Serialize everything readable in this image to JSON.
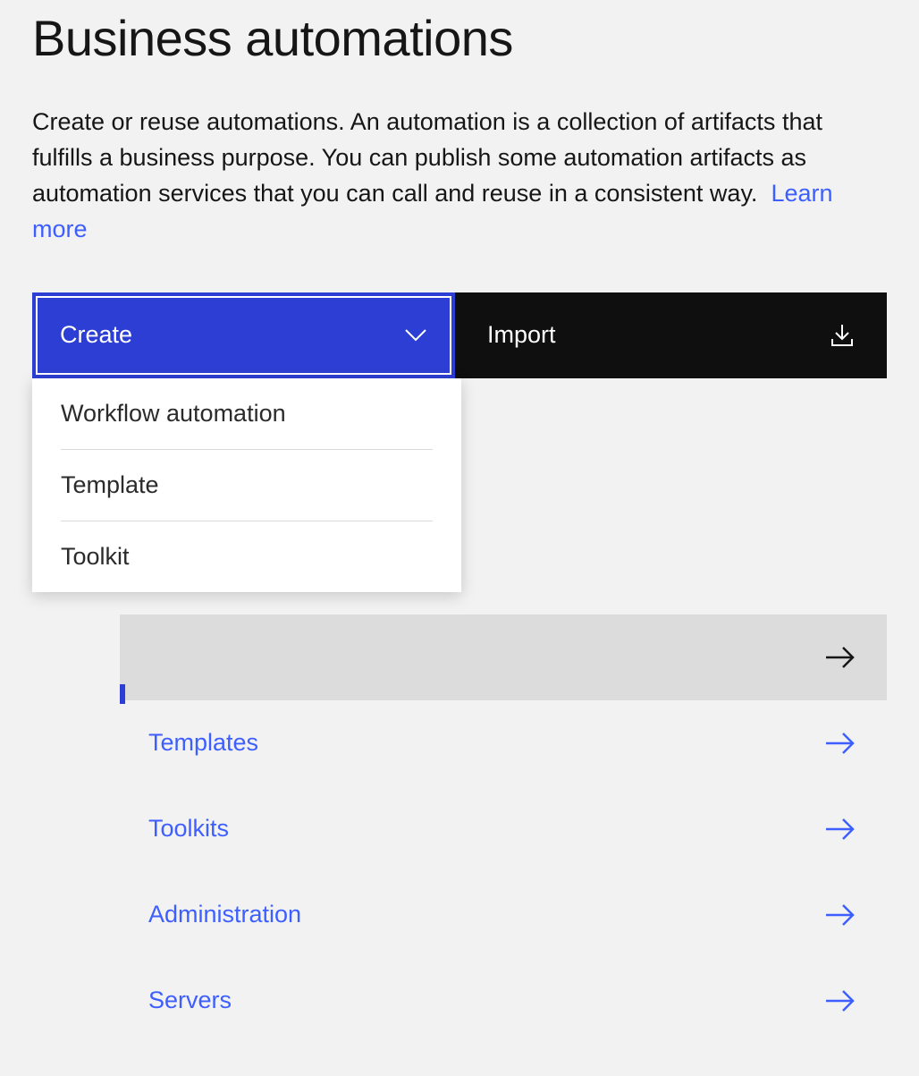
{
  "header": {
    "title": "Business automations",
    "description_part1": "Create or reuse automations. An automation is a collection of artifacts that fulfills a business purpose. You can publish some automation artifacts as automation services that you can call and reuse in a consistent way.  ",
    "learn_more": "Learn more"
  },
  "actions": {
    "create_label": "Create",
    "import_label": "Import",
    "create_dropdown": [
      "Workflow automation",
      "Template",
      "Toolkit"
    ]
  },
  "nav": {
    "items": [
      {
        "label": "",
        "active": true
      },
      {
        "label": "Templates",
        "active": false
      },
      {
        "label": "Toolkits",
        "active": false
      },
      {
        "label": "Administration",
        "active": false
      },
      {
        "label": "Servers",
        "active": false
      }
    ]
  }
}
